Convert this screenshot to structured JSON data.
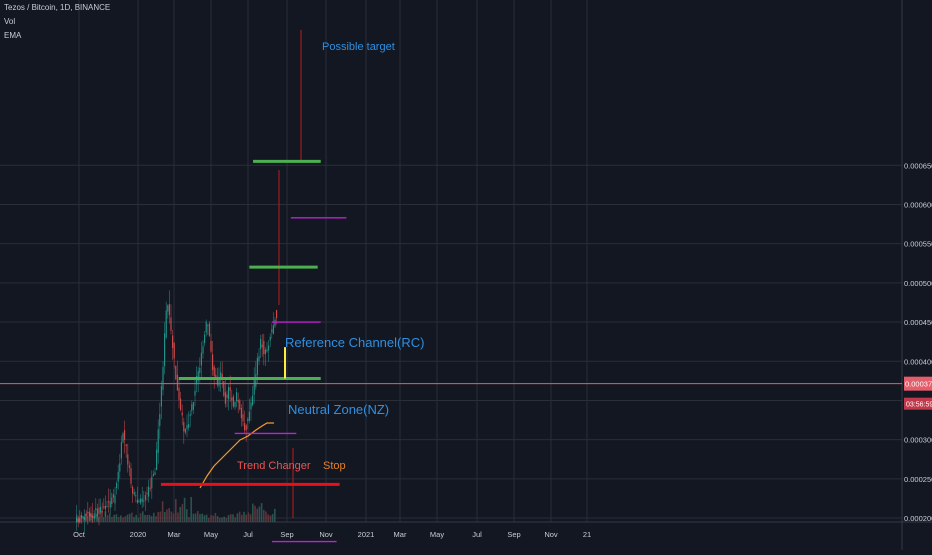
{
  "header": {
    "symbol_line": "Tezos / Bitcoin, 1D, BINANCE",
    "indicator_vol": "Vol",
    "indicator_ema": "EMA"
  },
  "price_scale": {
    "ticks": [
      "0.0006500",
      "0.0006000",
      "0.0005500",
      "0.0005000",
      "0.0004500",
      "0.0004000",
      "0.0003500",
      "0.0003000",
      "0.0002500",
      "0.0002000"
    ],
    "current_price": "0.0003714",
    "countdown": "03:56:59"
  },
  "time_axis": {
    "ticks": [
      "Oct",
      "2020",
      "Mar",
      "May",
      "Jul",
      "Sep",
      "Nov",
      "2021",
      "Mar",
      "May",
      "Jul",
      "Sep",
      "Nov",
      "21"
    ]
  },
  "annotations": {
    "possible_target": "Possible target",
    "reference_channel": "Reference Channel(RC)",
    "neutral_zone": "Neutral Zone(NZ)",
    "trend_changer": "Trend Changer",
    "stop": "Stop"
  },
  "colors": {
    "background": "#131722",
    "grid": "#2a2e39",
    "green_level": "#4caf50",
    "magenta_level": "#c020d8",
    "red_level": "#e8101a",
    "current_price_line": "#e35d6a",
    "label_blue": "#2f8fe0",
    "label_orange": "#e57f28",
    "label_red": "#ef5350",
    "ema": "#f59d2a",
    "up_candle": "#26a69a",
    "down_candle": "#ef5350",
    "measure_yellow": "#ffeb3b"
  },
  "chart_data": {
    "type": "candlestick",
    "title": "Tezos / Bitcoin, 1D, BINANCE",
    "y_range": [
      0.000165,
      0.00067
    ],
    "current_price": 0.0003714,
    "levels": [
      {
        "kind": "green",
        "value": 0.000655,
        "from": "2020-07",
        "to": "2020-10-20"
      },
      {
        "kind": "magenta",
        "value": 0.000583,
        "from": "2020-09",
        "to": "2020-12-01"
      },
      {
        "kind": "green",
        "value": 0.00052,
        "from": "2020-06-25",
        "to": "2020-10-15"
      },
      {
        "kind": "magenta",
        "value": 0.00045,
        "from": "2020-08",
        "to": "2020-10-20"
      },
      {
        "kind": "green",
        "value": 0.000378,
        "from": "2020-03",
        "to": "2020-10-20"
      },
      {
        "kind": "magenta",
        "value": 0.000308,
        "from": "2020-06",
        "to": "2020-09-10"
      },
      {
        "kind": "red",
        "value": 0.000243,
        "from": "2020-02",
        "to": "2020-11-20"
      },
      {
        "kind": "magenta",
        "value": 0.00017,
        "from": "2020-08",
        "to": "2020-11-15"
      }
    ],
    "measure": {
      "from": 0.000378,
      "to": 0.000418
    },
    "ema_series": [
      {
        "x": "2020-04-15",
        "y": 0.000205
      },
      {
        "x": "2020-05-15",
        "y": 0.000232
      },
      {
        "x": "2020-06-15",
        "y": 0.000255
      },
      {
        "x": "2020-07-15",
        "y": 0.000267
      },
      {
        "x": "2020-08-01",
        "y": 0.000268
      }
    ]
  }
}
